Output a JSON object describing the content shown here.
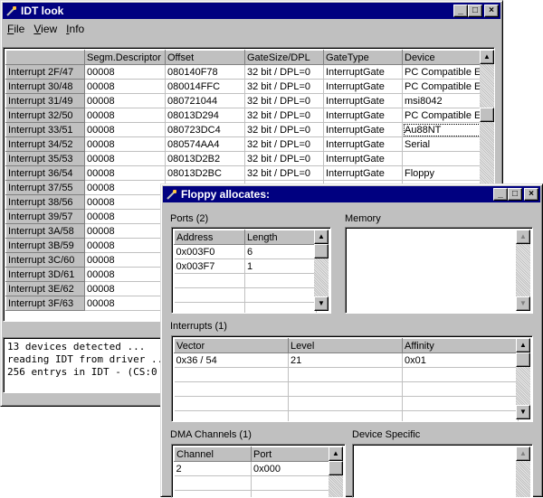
{
  "main_window": {
    "title": "IDT look",
    "menu": [
      {
        "accel": "F",
        "rest": "ile"
      },
      {
        "accel": "V",
        "rest": "iew"
      },
      {
        "accel": "I",
        "rest": "nfo"
      }
    ],
    "columns": [
      "",
      "Segm.Descriptor",
      "Offset",
      "GateSize/DPL",
      "GateType",
      "Device"
    ],
    "rows": [
      [
        "Interrupt 2F/47",
        "00008",
        "080140F78",
        "32 bit / DPL=0",
        "InterruptGate",
        "PC Compatible Eis"
      ],
      [
        "Interrupt 30/48",
        "00008",
        "080014FFC",
        "32 bit / DPL=0",
        "InterruptGate",
        "PC Compatible Eis"
      ],
      [
        "Interrupt 31/49",
        "00008",
        "080721044",
        "32 bit / DPL=0",
        "InterruptGate",
        "msi8042"
      ],
      [
        "Interrupt 32/50",
        "00008",
        "08013D294",
        "32 bit / DPL=0",
        "InterruptGate",
        "PC Compatible Eis"
      ],
      [
        "Interrupt 33/51",
        "00008",
        "080723DC4",
        "32 bit / DPL=0",
        "InterruptGate",
        "Au88NT"
      ],
      [
        "Interrupt 34/52",
        "00008",
        "080574AA4",
        "32 bit / DPL=0",
        "InterruptGate",
        "Serial"
      ],
      [
        "Interrupt 35/53",
        "00008",
        "08013D2B2",
        "32 bit / DPL=0",
        "InterruptGate",
        ""
      ],
      [
        "Interrupt 36/54",
        "00008",
        "08013D2BC",
        "32 bit / DPL=0",
        "InterruptGate",
        "Floppy"
      ],
      [
        "Interrupt 37/55",
        "00008",
        "",
        "",
        "",
        ""
      ],
      [
        "Interrupt 38/56",
        "00008",
        "",
        "",
        "",
        ""
      ],
      [
        "Interrupt 39/57",
        "00008",
        "",
        "",
        "",
        ""
      ],
      [
        "Interrupt 3A/58",
        "00008",
        "",
        "",
        "",
        ""
      ],
      [
        "Interrupt 3B/59",
        "00008",
        "",
        "",
        "",
        ""
      ],
      [
        "Interrupt 3C/60",
        "00008",
        "",
        "",
        "",
        ""
      ],
      [
        "Interrupt 3D/61",
        "00008",
        "",
        "",
        "",
        ""
      ],
      [
        "Interrupt 3E/62",
        "00008",
        "",
        "",
        "",
        ""
      ],
      [
        "Interrupt 3F/63",
        "00008",
        "",
        "",
        "",
        ""
      ]
    ],
    "log": [
      "13 devices detected ...",
      "reading IDT from driver ...",
      "256 entrys in IDT - (CS:0"
    ]
  },
  "floppy_window": {
    "title": "Floppy allocates:",
    "ports": {
      "label": "Ports (2)",
      "columns": [
        "Address",
        "Length"
      ],
      "rows": [
        [
          "0x003F0",
          "6"
        ],
        [
          "0x003F7",
          "1"
        ]
      ]
    },
    "memory": {
      "label": "Memory"
    },
    "interrupts": {
      "label": "Interrupts (1)",
      "columns": [
        "Vector",
        "Level",
        "Affinity"
      ],
      "rows": [
        [
          "0x36 / 54",
          "21",
          "0x01"
        ]
      ]
    },
    "dma": {
      "label": "DMA Channels (1)",
      "columns": [
        "Channel",
        "Port"
      ],
      "rows": [
        [
          "2",
          "0x000"
        ]
      ]
    },
    "device_specific": {
      "label": "Device Specific"
    }
  },
  "colors": {
    "titlebar": "#000080",
    "face": "#c0c0c0",
    "window": "#ffffff"
  }
}
